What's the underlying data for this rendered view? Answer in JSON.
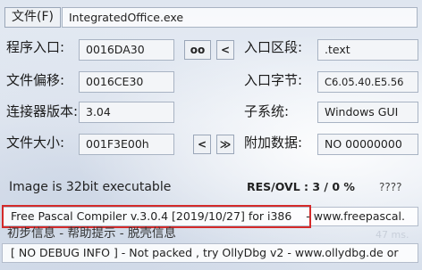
{
  "file": {
    "button_label": "文件(F)",
    "path": "IntegratedOffice.exe"
  },
  "entry_point": {
    "label": "程序入口:",
    "value": "0016DA30",
    "oo_button": "oo",
    "prev_button": "<"
  },
  "entry_section": {
    "label": "入口区段:",
    "value": ".text"
  },
  "file_offset": {
    "label": "文件偏移:",
    "value": "0016CE30"
  },
  "entry_bytes": {
    "label": "入口字节:",
    "value": "C6.05.40.E5.56"
  },
  "linker": {
    "label": "连接器版本:",
    "value": "3.04"
  },
  "subsystem": {
    "label": "子系统:",
    "value": "Windows GUI"
  },
  "file_size": {
    "label": "文件大小:",
    "value": "001F3E00h",
    "prev_button": "<",
    "next_button": "≫"
  },
  "overlay": {
    "label": "附加数据:",
    "value": "NO  00000000"
  },
  "status": {
    "arch": "Image is 32bit executable",
    "res_ovl": "RES/OVL : 3 / 0 %",
    "unknown": "????"
  },
  "detection": {
    "compiler": "Free Pascal Compiler v.3.0.4 [2019/10/27] for i386",
    "website": "- www.freepascal."
  },
  "hints": {
    "title": "初步信息 - 帮助提示 - 脱壳信息",
    "time": "47 ms."
  },
  "debug_info": "[ NO DEBUG INFO ] - Not packed , try OllyDbg v2 - www.ollydbg.de or",
  "colors": {
    "highlight_border": "#d42a2a",
    "field_bg": "#f3f5f8"
  }
}
